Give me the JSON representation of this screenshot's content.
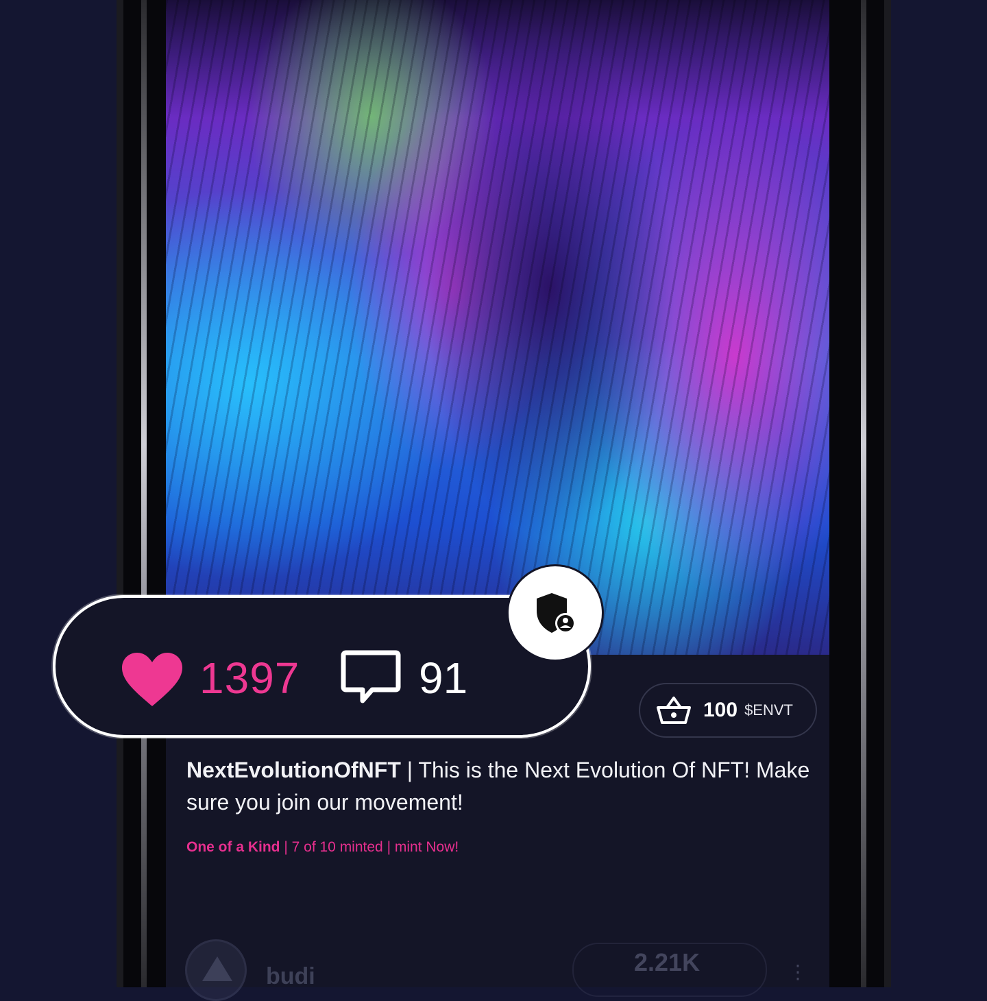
{
  "post": {
    "artwork_alt": "",
    "price": {
      "amount": "100",
      "token": "$ENVT"
    },
    "handle": "NextEvolutionOfNFT",
    "caption": "| This is the Next Evolution Of NFT! Make sure you join our movement!",
    "edition": {
      "kind": "One of a Kind",
      "minted": "| 7 of 10 minted",
      "cta": "| mint Now!"
    }
  },
  "stats": {
    "likes": "1397",
    "comments": "91"
  },
  "next_post": {
    "user": "budi",
    "count": "2.21K",
    "more": "⋮"
  },
  "colors": {
    "accent_pink": "#ee3892",
    "background": "#141631",
    "card": "#141527"
  },
  "icons": {
    "like": "heart-icon",
    "comment": "comment-icon",
    "badge": "shield-user-icon",
    "basket": "basket-icon"
  }
}
